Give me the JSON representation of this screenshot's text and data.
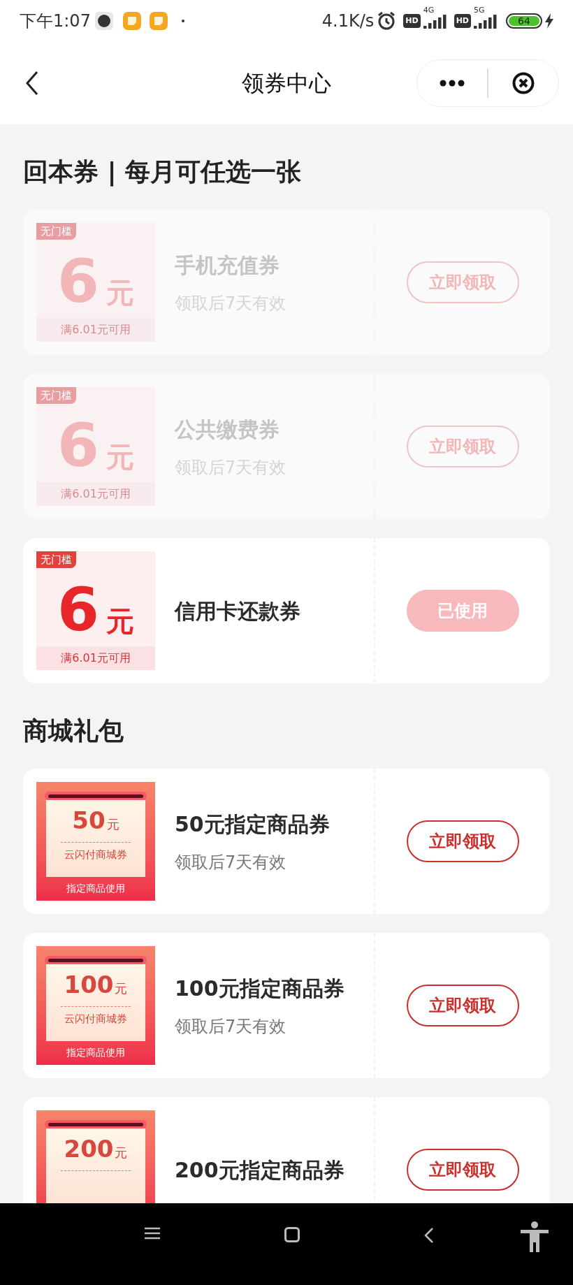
{
  "status_bar": {
    "time": "下午1:07",
    "speed": "4.1K/s",
    "hd_badges": [
      "HD",
      "HD"
    ],
    "networks": [
      "4G",
      "5G"
    ],
    "battery": "64"
  },
  "header": {
    "title": "领券中心"
  },
  "sections": [
    {
      "title": "回本券 | 每月可任选一张",
      "kind": "cash",
      "coupons": [
        {
          "badge": "无门槛",
          "amount": "6",
          "unit": "元",
          "condition": "满6.01元可用",
          "name": "手机充值券",
          "validity": "领取后7天有效",
          "disabled": true,
          "button": {
            "label": "立即领取",
            "kind": "outline"
          }
        },
        {
          "badge": "无门槛",
          "amount": "6",
          "unit": "元",
          "condition": "满6.01元可用",
          "name": "公共缴费券",
          "validity": "领取后7天有效",
          "disabled": true,
          "button": {
            "label": "立即领取",
            "kind": "outline"
          }
        },
        {
          "badge": "无门槛",
          "amount": "6",
          "unit": "元",
          "condition": "满6.01元可用",
          "name": "信用卡还款券",
          "disabled": false,
          "button": {
            "label": "已使用",
            "kind": "filled"
          }
        }
      ]
    },
    {
      "title": "商城礼包",
      "kind": "mall",
      "coupons": [
        {
          "amount": "50",
          "unit": "元",
          "ticket_name": "云闪付商城券",
          "footer": "指定商品使用",
          "name": "50元指定商品券",
          "validity": "领取后7天有效",
          "disabled": false,
          "button": {
            "label": "立即领取",
            "kind": "outline"
          }
        },
        {
          "amount": "100",
          "unit": "元",
          "ticket_name": "云闪付商城券",
          "footer": "指定商品使用",
          "name": "100元指定商品券",
          "validity": "领取后7天有效",
          "disabled": false,
          "button": {
            "label": "立即领取",
            "kind": "outline"
          }
        },
        {
          "amount": "200",
          "unit": "元",
          "name": "200元指定商品券",
          "disabled": false,
          "button": {
            "label": "立即领取",
            "kind": "outline"
          }
        }
      ]
    }
  ]
}
